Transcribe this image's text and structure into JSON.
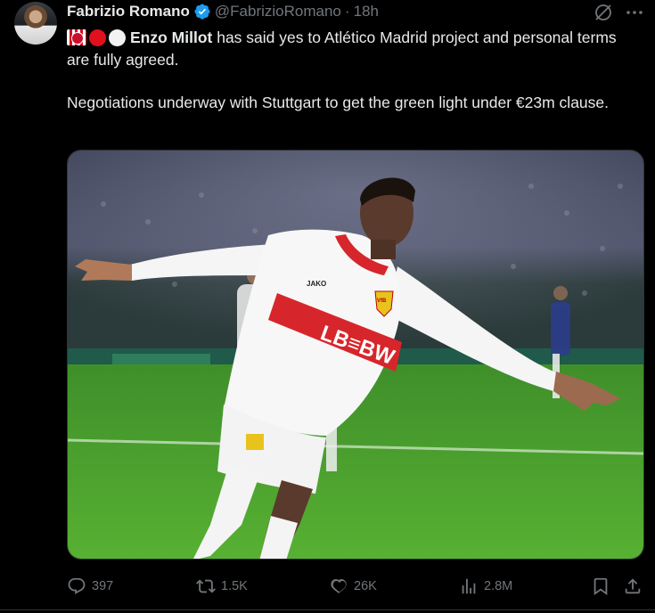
{
  "author": {
    "name": "Fabrizio Romano",
    "handle": "@FabrizioRomano",
    "separator": "·",
    "time": "18h",
    "verified_color": "#1d9bf0"
  },
  "tweet": {
    "flags": [
      "atletico-flag",
      "red-circle",
      "white-circle"
    ],
    "player_name": "Enzo Millot",
    "line1_rest": " has said yes to Atlético Madrid project and personal terms are fully agreed.",
    "para2": "Negotiations underway with Stuttgart to get the green light under €23m clause."
  },
  "media": {
    "sponsor_text": "LB≡BW",
    "kit_brand": "JAKO",
    "club_badge": "VfB"
  },
  "actions": {
    "replies": "397",
    "reposts": "1.5K",
    "likes": "26K",
    "views": "2.8M"
  },
  "icons": {
    "grok": "grok-icon",
    "more": "more-icon",
    "reply": "reply-icon",
    "repost": "repost-icon",
    "like": "heart-icon",
    "views": "views-icon",
    "bookmark": "bookmark-icon",
    "share": "share-icon"
  }
}
